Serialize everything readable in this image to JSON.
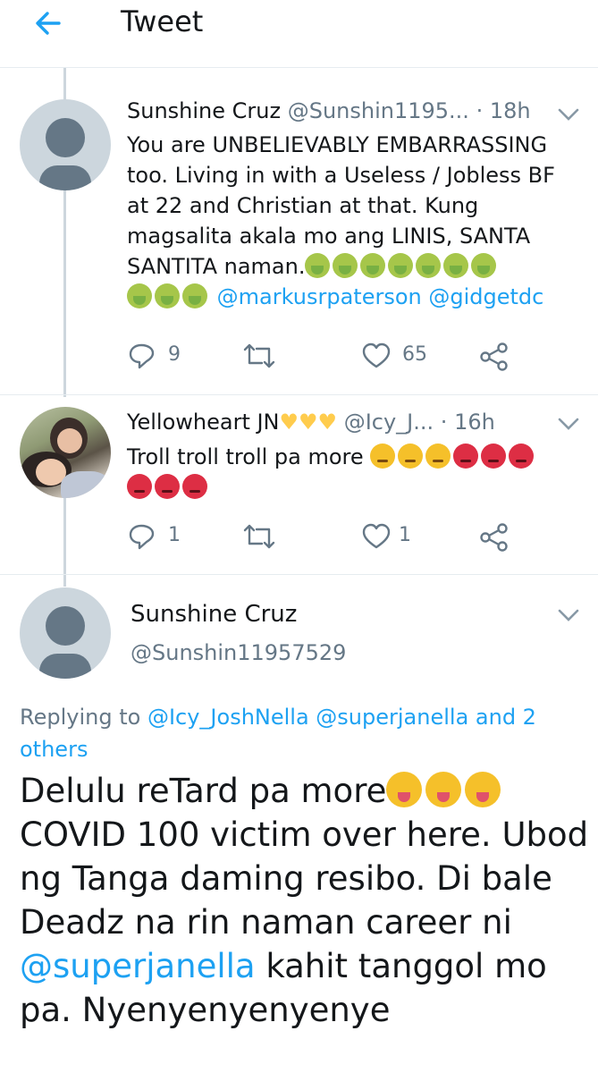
{
  "header": {
    "title": "Tweet",
    "back_icon": "arrow-left-icon",
    "accent": "#1da1f2"
  },
  "replies": [
    {
      "name": "Sunshine Cruz",
      "handle": "@Sunshin1195...",
      "dot": "·",
      "time": "18h",
      "text_lines": [
        "You are UNBELIEVABLY EMBARRASSING",
        "too. Living in with a Useless / Jobless BF",
        "at 22 and Christian at that. Kung",
        "magsalita akala mo ang LINIS, SANTA",
        "SANTITA naman."
      ],
      "emoji_name": "nauseated-face-icon",
      "emoji_count": 10,
      "mentions": "@markusrpaterson @gidgetdc",
      "counts": {
        "reply": "9",
        "like": "65"
      }
    },
    {
      "name": "Yellowheart JN",
      "handle": "@Icy_J...",
      "dot": "·",
      "time": "16h",
      "text": "Troll troll troll pa more",
      "emojis": [
        "angry-face-icon",
        "angry-face-icon",
        "angry-face-icon",
        "pouting-face-icon",
        "pouting-face-icon",
        "pouting-face-icon",
        "pouting-face-icon",
        "pouting-face-icon",
        "pouting-face-icon"
      ],
      "counts": {
        "reply": "1",
        "like": "1"
      }
    }
  ],
  "main_tweet": {
    "name": "Sunshine Cruz",
    "handle": "@Sunshin11957529",
    "replying_prefix": "Replying to",
    "replying_line1_links": "@Icy_JoshNella @superjanella and 2",
    "replying_line2": "others",
    "text_part1": "Delulu reTard pa more",
    "emojis": [
      "winking-face-tongue-icon",
      "squinting-face-tongue-icon",
      "face-with-tongue-icon"
    ],
    "text_part2": "COVID 100 victim over here. Ubod ng Tanga daming resibo. Di bale Deadz na rin naman career ni",
    "mention": "@superjanella",
    "text_part3": "kahit tanggol mo pa. Nyenyenyenyenye"
  }
}
